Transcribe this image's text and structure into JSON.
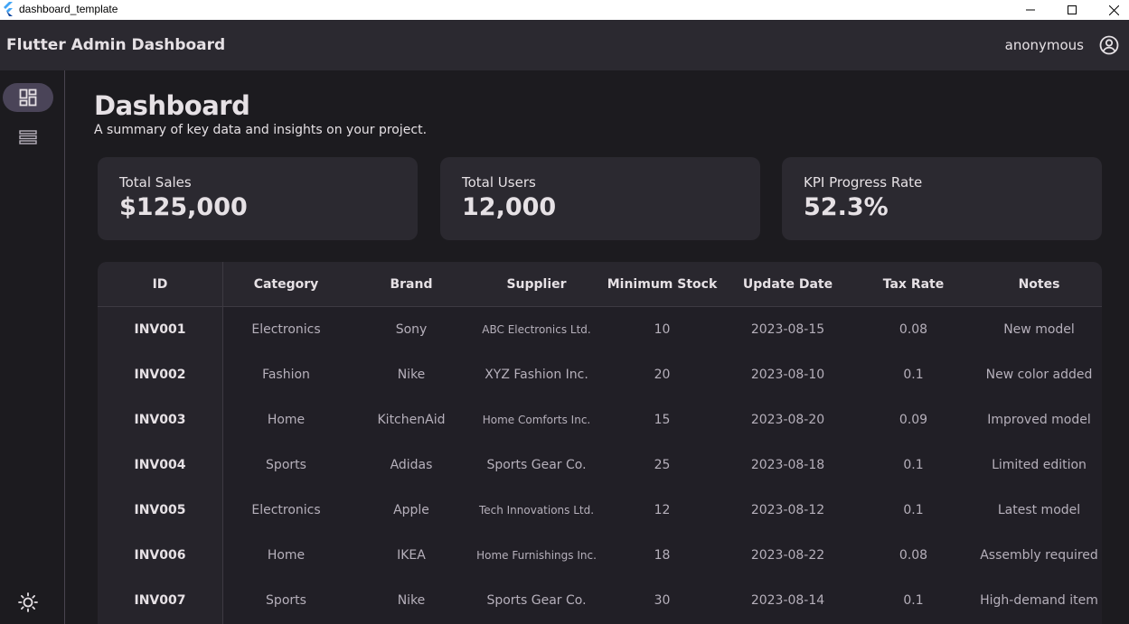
{
  "window": {
    "title": "dashboard_template"
  },
  "appbar": {
    "title": "Flutter Admin Dashboard",
    "user": "anonymous"
  },
  "page": {
    "title": "Dashboard",
    "subtitle": "A summary of key data and insights on your project."
  },
  "cards": [
    {
      "label": "Total Sales",
      "value": "$125,000"
    },
    {
      "label": "Total Users",
      "value": "12,000"
    },
    {
      "label": "KPI Progress Rate",
      "value": "52.3%"
    }
  ],
  "table": {
    "headers": [
      "ID",
      "Category",
      "Brand",
      "Supplier",
      "Minimum Stock",
      "Update Date",
      "Tax Rate",
      "Notes"
    ],
    "rows": [
      [
        "INV001",
        "Electronics",
        "Sony",
        "ABC Electronics Ltd.",
        "10",
        "2023-08-15",
        "0.08",
        "New model"
      ],
      [
        "INV002",
        "Fashion",
        "Nike",
        "XYZ Fashion Inc.",
        "20",
        "2023-08-10",
        "0.1",
        "New color added"
      ],
      [
        "INV003",
        "Home",
        "KitchenAid",
        "Home Comforts Inc.",
        "15",
        "2023-08-20",
        "0.09",
        "Improved model"
      ],
      [
        "INV004",
        "Sports",
        "Adidas",
        "Sports Gear Co.",
        "25",
        "2023-08-18",
        "0.1",
        "Limited edition"
      ],
      [
        "INV005",
        "Electronics",
        "Apple",
        "Tech Innovations Ltd.",
        "12",
        "2023-08-12",
        "0.1",
        "Latest model"
      ],
      [
        "INV006",
        "Home",
        "IKEA",
        "Home Furnishings Inc.",
        "18",
        "2023-08-22",
        "0.08",
        "Assembly required"
      ],
      [
        "INV007",
        "Sports",
        "Nike",
        "Sports Gear Co.",
        "30",
        "2023-08-14",
        "0.1",
        "High-demand item"
      ]
    ]
  },
  "nav": {
    "items": [
      {
        "icon": "dashboard-icon",
        "active": true
      },
      {
        "icon": "list-icon",
        "active": false
      }
    ],
    "theme_icon": "light-mode-icon"
  },
  "colors": {
    "background": "#1c1b1f",
    "surface": "#2b2930",
    "accent": "#4a4458",
    "text": "#e6e1e5",
    "text_secondary": "#b6b0bb"
  }
}
